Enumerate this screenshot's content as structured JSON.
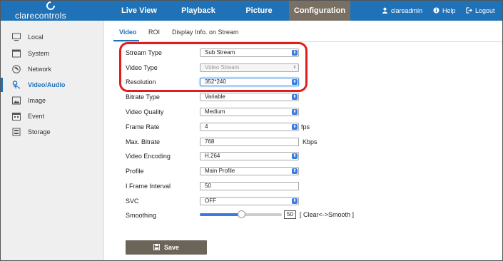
{
  "brand": {
    "name": "clarecontrols"
  },
  "nav": {
    "items": [
      {
        "label": "Live View",
        "active": false
      },
      {
        "label": "Playback",
        "active": false
      },
      {
        "label": "Picture",
        "active": false
      },
      {
        "label": "Configuration",
        "active": true
      }
    ],
    "user": "clareadmin",
    "help": "Help",
    "logout": "Logout"
  },
  "sidebar": {
    "items": [
      {
        "label": "Local",
        "icon": "monitor-icon",
        "active": false
      },
      {
        "label": "System",
        "icon": "window-icon",
        "active": false
      },
      {
        "label": "Network",
        "icon": "globe-icon",
        "active": false
      },
      {
        "label": "Video/Audio",
        "icon": "mic-icon",
        "active": true
      },
      {
        "label": "Image",
        "icon": "image-icon",
        "active": false
      },
      {
        "label": "Event",
        "icon": "calendar-icon",
        "active": false
      },
      {
        "label": "Storage",
        "icon": "storage-icon",
        "active": false
      }
    ]
  },
  "tabs": [
    {
      "label": "Video",
      "active": true
    },
    {
      "label": "ROI",
      "active": false
    },
    {
      "label": "Display Info. on Stream",
      "active": false
    }
  ],
  "form": {
    "stream_type": {
      "label": "Stream Type",
      "value": "Sub Stream"
    },
    "video_type": {
      "label": "Video Type",
      "value": "Video Stream"
    },
    "resolution": {
      "label": "Resolution",
      "value": "352*240"
    },
    "bitrate_type": {
      "label": "Bitrate Type",
      "value": "Variable"
    },
    "video_quality": {
      "label": "Video Quality",
      "value": "Medium"
    },
    "frame_rate": {
      "label": "Frame Rate",
      "value": "4",
      "unit": "fps"
    },
    "max_bitrate": {
      "label": "Max. Bitrate",
      "value": "768",
      "unit": "Kbps"
    },
    "video_encoding": {
      "label": "Video Encoding",
      "value": "H.264"
    },
    "profile": {
      "label": "Profile",
      "value": "Main Profile"
    },
    "i_frame_interval": {
      "label": "I Frame Interval",
      "value": "50"
    },
    "svc": {
      "label": "SVC",
      "value": "OFF"
    },
    "smoothing": {
      "label": "Smoothing",
      "value": "50",
      "hint": "[ Clear<->Smooth ]"
    }
  },
  "save_label": "Save",
  "colors": {
    "accent": "#1f72b8",
    "highlight": "#e01e1e",
    "active_nav": "#7a6f63"
  }
}
